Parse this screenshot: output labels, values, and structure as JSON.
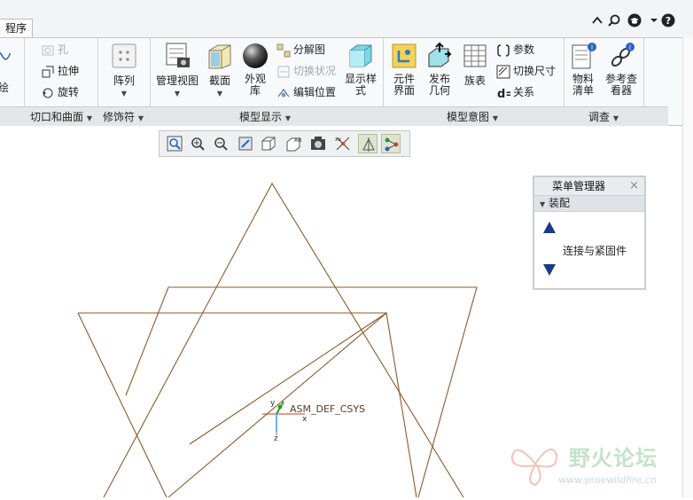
{
  "window": {
    "title_fragment": "",
    "active_tab": "程序"
  },
  "top_icons": [
    "up-arrow-icon",
    "search-icon",
    "graduation-cap-icon",
    "dropdown-icon",
    "help-icon"
  ],
  "ribbon": {
    "groups": [
      {
        "id": "cut_surface",
        "label": "切口和曲面",
        "first_partial_label": "绘",
        "small_buttons": [
          {
            "label": "孔",
            "icon": "hole-icon",
            "disabled": true
          },
          {
            "label": "拉伸",
            "icon": "extrude-icon",
            "disabled": false
          },
          {
            "label": "旋转",
            "icon": "revolve-icon",
            "disabled": false
          }
        ]
      },
      {
        "id": "modifier",
        "label": "修饰符",
        "big_buttons": [
          {
            "label": "阵列",
            "icon": "pattern-icon"
          }
        ]
      },
      {
        "id": "model_display",
        "label": "模型显示",
        "big_buttons": [
          {
            "label": "管理视图",
            "icon": "manage-views-icon"
          },
          {
            "label": "截面",
            "icon": "section-icon"
          },
          {
            "label": "外观\n库",
            "icon": "appearance-sphere-icon"
          },
          {
            "label": "显示样\n式",
            "icon": "display-style-icon"
          }
        ],
        "small_buttons": [
          {
            "label": "分解图",
            "icon": "exploded-view-icon",
            "disabled": false
          },
          {
            "label": "切换状况",
            "icon": "toggle-status-icon",
            "disabled": true
          },
          {
            "label": "编辑位置",
            "icon": "edit-position-icon",
            "disabled": false
          }
        ]
      },
      {
        "id": "model_intent",
        "label": "模型意图",
        "big_buttons": [
          {
            "label": "元件\n界面",
            "icon": "component-interface-icon"
          },
          {
            "label": "发布\n几何",
            "icon": "publish-geometry-icon"
          },
          {
            "label": "族表",
            "icon": "family-table-icon"
          }
        ],
        "small_buttons": [
          {
            "label": "参数",
            "icon": "parameters-icon",
            "disabled": false
          },
          {
            "label": "切换尺寸",
            "icon": "switch-dimensions-icon",
            "disabled": false
          },
          {
            "label": "关系",
            "icon": "relations-icon",
            "disabled": false
          }
        ]
      },
      {
        "id": "investigate",
        "label": "调查",
        "big_buttons": [
          {
            "label": "物料\n清单",
            "icon": "bill-of-materials-icon"
          },
          {
            "label": "参考查\n看器",
            "icon": "reference-viewer-icon"
          }
        ]
      }
    ]
  },
  "graphics_toolbar": [
    "refit-icon",
    "zoom-in-icon",
    "zoom-out-icon",
    "repaint-icon",
    "view-orientation-icon",
    "saved-views-icon",
    "display-style-icon",
    "datum-display-icon",
    "spin-center-icon",
    "annotation-display-icon"
  ],
  "menu_manager": {
    "title": "菜单管理器",
    "close": "×",
    "section": "装配",
    "item": "连接与紧固件"
  },
  "canvas": {
    "csys_label": "ASM_DEF_CSYS",
    "axis_x": "x",
    "axis_y": "y",
    "axis_z": "z",
    "line_color": "#8b5a2b"
  },
  "watermark": {
    "text": "野火论坛",
    "url": "www.proewildfire.cn"
  }
}
